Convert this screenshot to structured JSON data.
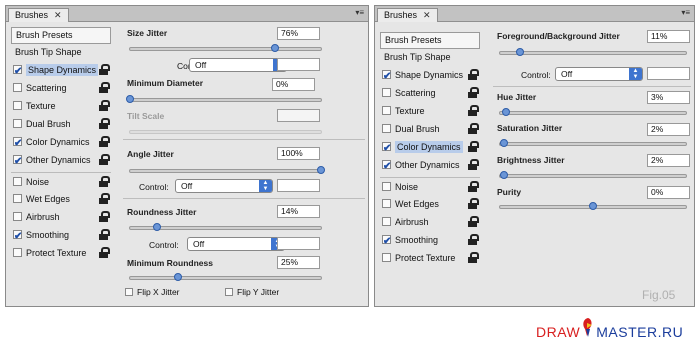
{
  "left_panel": {
    "tab": {
      "label": "Brushes",
      "close": "✕"
    },
    "menu_glyph": "▾≡",
    "sidebar": {
      "header": "Brush Presets",
      "tip_shape": "Brush Tip Shape",
      "items": [
        {
          "label": "Shape Dynamics",
          "checked": true,
          "selected": true
        },
        {
          "label": "Scattering",
          "checked": false
        },
        {
          "label": "Texture",
          "checked": false
        },
        {
          "label": "Dual Brush",
          "checked": false
        },
        {
          "label": "Color Dynamics",
          "checked": true
        },
        {
          "label": "Other Dynamics",
          "checked": true
        },
        {
          "label": "Noise",
          "checked": false
        },
        {
          "label": "Wet Edges",
          "checked": false
        },
        {
          "label": "Airbrush",
          "checked": false
        },
        {
          "label": "Smoothing",
          "checked": true
        },
        {
          "label": "Protect Texture",
          "checked": false
        }
      ]
    },
    "settings": {
      "size_jitter": {
        "label": "Size Jitter",
        "value": "76%",
        "level": 0.76
      },
      "size_control": {
        "label": "Control:",
        "value": "Off"
      },
      "min_diameter": {
        "label": "Minimum Diameter",
        "value": "0%",
        "level": 0.0
      },
      "tilt_scale": {
        "label": "Tilt Scale",
        "value": ""
      },
      "angle_jitter": {
        "label": "Angle Jitter",
        "value": "100%",
        "level": 1.0
      },
      "angle_control": {
        "label": "Control:",
        "value": "Off"
      },
      "roundness_jitter": {
        "label": "Roundness Jitter",
        "value": "14%",
        "level": 0.14
      },
      "roundness_control": {
        "label": "Control:",
        "value": "Off"
      },
      "min_roundness": {
        "label": "Minimum Roundness",
        "value": "25%",
        "level": 0.25
      },
      "flip_x": {
        "label": "Flip X Jitter",
        "checked": false
      },
      "flip_y": {
        "label": "Flip Y Jitter",
        "checked": false
      }
    }
  },
  "right_panel": {
    "tab": {
      "label": "Brushes",
      "close": "✕"
    },
    "menu_glyph": "▾≡",
    "sidebar": {
      "header": "Brush Presets",
      "tip_shape": "Brush Tip Shape",
      "items": [
        {
          "label": "Shape Dynamics",
          "checked": true
        },
        {
          "label": "Scattering",
          "checked": false
        },
        {
          "label": "Texture",
          "checked": false
        },
        {
          "label": "Dual Brush",
          "checked": false
        },
        {
          "label": "Color Dynamics",
          "checked": true,
          "selected": true
        },
        {
          "label": "Other Dynamics",
          "checked": true
        },
        {
          "label": "Noise",
          "checked": false
        },
        {
          "label": "Wet Edges",
          "checked": false
        },
        {
          "label": "Airbrush",
          "checked": false
        },
        {
          "label": "Smoothing",
          "checked": true
        },
        {
          "label": "Protect Texture",
          "checked": false
        }
      ]
    },
    "settings": {
      "fg_bg_jitter": {
        "label": "Foreground/Background Jitter",
        "value": "11%",
        "level": 0.11
      },
      "fg_bg_control": {
        "label": "Control:",
        "value": "Off"
      },
      "hue_jitter": {
        "label": "Hue Jitter",
        "value": "3%",
        "level": 0.03
      },
      "saturation_jitter": {
        "label": "Saturation Jitter",
        "value": "2%",
        "level": 0.02
      },
      "brightness_jitter": {
        "label": "Brightness Jitter",
        "value": "2%",
        "level": 0.02
      },
      "purity": {
        "label": "Purity",
        "value": "0%",
        "level": 0.5
      }
    }
  },
  "figure_label": "Fig.05",
  "logo": {
    "part1": "DRAW",
    "part2": "MASTER.RU"
  },
  "colors": {
    "accent": "#3e74cf",
    "selection": "#b8ccea",
    "logo_red": "#d81f1f",
    "logo_blue": "#1b3d9c"
  }
}
